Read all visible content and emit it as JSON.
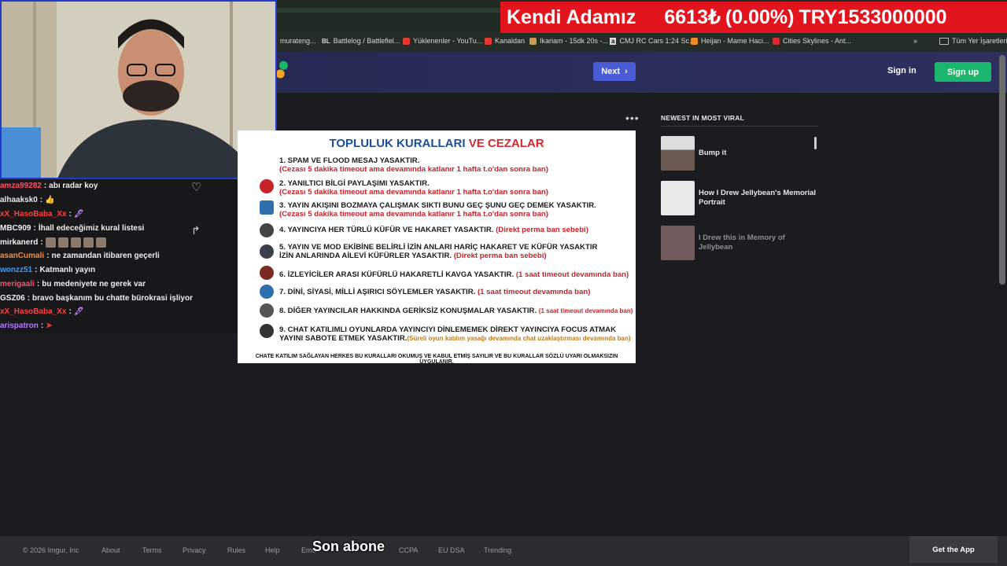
{
  "ticker": {
    "name": "Kendi Adamız",
    "value": "6613₺",
    "change": "(0.00%)",
    "mcap": "TRY1533000000"
  },
  "bookmarks": [
    {
      "label": "murateng...",
      "color": "#555"
    },
    {
      "label": "Battlelog / Battlefiel...",
      "color": "#e8e8e8",
      "glyph": "BL"
    },
    {
      "label": "Yüklenenler - YouTu...",
      "color": "#e53935"
    },
    {
      "label": "Kanaldan",
      "color": "#e53935"
    },
    {
      "label": "Ikariam - 15dk 20s -...",
      "color": "#c99b54"
    },
    {
      "label": "CMJ RC Cars 1:24 Sc...",
      "color": "#ddd",
      "glyph": "a"
    },
    {
      "label": "Heijan - Mame Haci...",
      "color": "#f08a24"
    },
    {
      "label": "Cities Skylines - Ant...",
      "color": "#d32f2f"
    },
    {
      "label": "Tüm Yer İşaretleri",
      "color": "#999"
    }
  ],
  "header": {
    "next_label": "Next",
    "signin_label": "Sign in",
    "signup_label": "Sign up"
  },
  "chat": [
    {
      "user": "amza99282",
      "user_color": "#ff4f6b",
      "text": "abı radar koy"
    },
    {
      "user": "alhaaksk0",
      "user_color": "#e8e8e8",
      "text": "👍"
    },
    {
      "user": "xX_HasoBaba_Xx",
      "user_color": "#ff4040",
      "text": "🖋"
    },
    {
      "user": "MBC909",
      "user_color": "#f0f0f0",
      "text": "İhall edeceğimiz kural listesi"
    },
    {
      "user": "mirkanerd",
      "user_color": "#f0f0f0",
      "text": ""
    },
    {
      "user": "asanCumali",
      "user_color": "#ff8a3a",
      "text": "ne zamandan itibaren geçerli"
    },
    {
      "user": "wonzz51",
      "user_color": "#3aa0ff",
      "text": "Katmanlı yayın"
    },
    {
      "user": "merigaali",
      "user_color": "#ff4f6b",
      "text": "bu medeniyete ne gerek var"
    },
    {
      "user": "GSZ06",
      "user_color": "#f0f0f0",
      "text": "bravo başkanım bu chatte bürokrasi işliyor"
    },
    {
      "user": "xX_HasoBaba_Xx",
      "user_color": "#ff4040",
      "text": "🖋"
    },
    {
      "user": "arispatron",
      "user_color": "#b07aff",
      "text": "➤"
    }
  ],
  "rules": {
    "title_a": "TOPLULUK KURALLARI",
    "title_b": "VE CEZALAR",
    "items": [
      {
        "text": "1. SPAM VE FLOOD MESAJ YASAKTIR.",
        "penalty": "(Cezası 5 dakika timeout ama devamında katlanır 1 hafta t.o'dan sonra ban)"
      },
      {
        "text": "2. YANILTICI BİLGİ PAYLAŞIMI YASAKTIR.",
        "penalty": "(Cezası 5 dakika timeout ama devamında katlanır 1 hafta t.o'dan sonra ban)"
      },
      {
        "text": "3. YAYIN AKIŞINI BOZMAYA ÇALIŞMAK SIKTI BUNU GEÇ ŞUNU GEÇ DEMEK YASAKTIR.",
        "penalty": "(Cezası 5 dakika timeout ama devamında katlanır 1 hafta t.o'dan sonra ban)"
      },
      {
        "text": "4. YAYINCIYA HER TÜRLÜ KÜFÜR VE HAKARET YASAKTIR.",
        "penalty": "(Direkt perma ban sebebi)"
      },
      {
        "text": "5. YAYIN VE MOD EKİBİNE BELİRLİ İZİN ANLARI HARİÇ HAKARET VE KÜFÜR YASAKTIR",
        "text2": "İZİN ANLARINDA AİLEVİ KÜFÜRLER YASAKTIR.",
        "penalty": "(Direkt perma ban sebebi)"
      },
      {
        "text": "6. İZLEYİCİLER ARASI KÜFÜRLÜ HAKARETLİ KAVGA YASAKTIR.",
        "penalty": "(1 saat timeout devamında ban)"
      },
      {
        "text": "7. DİNİ, SİYASİ, MİLLİ AŞIRICI SÖYLEMLER YASAKTIR.",
        "penalty": "(1 saat timeout devamında ban)"
      },
      {
        "text": "8. DİĞER YAYINCILAR HAKKINDA GERİKSİZ KONUŞMALAR YASAKTIR.",
        "penalty": "(1 saat timeout devamında ban)"
      },
      {
        "text": "9. CHAT KATILIMLI OYUNLARDA YAYINCIYI DİNLEMEMEK DİREKT YAYINCIYA FOCUS ATMAK",
        "text2": "YAYINI SABOTE ETMEK YASAKTIR.",
        "penalty": "(Süreli oyun katılım yasağı devamında chat uzaklaştırması devamında ban)"
      }
    ],
    "footer": "CHATE KATILIM SAĞLAYAN HERKES BU KURALLARI OKUMUŞ VE KABUL ETMİŞ SAYILIR VE BU KURALLAR SÖZLÜ UYARI OLMAKSIZIN UYGULANIR."
  },
  "sidebar": {
    "title": "NEWEST IN MOST VIRAL",
    "items": [
      {
        "label": "Bump it",
        "thumb": "#6b5a52"
      },
      {
        "label": "How I Drew Jellybean's Memorial Portrait",
        "thumb": "#e8e8e8"
      },
      {
        "label": "I Drew this in Memory of Jellybean",
        "thumb": "#b98f8f"
      }
    ]
  },
  "footer": {
    "links": [
      "© 2026 Imgur, Inc",
      "About",
      "Terms",
      "Privacy",
      "Rules",
      "Help",
      "Emo",
      "CCPA",
      "EU DSA",
      "Trending"
    ],
    "get_app": "Get the App"
  },
  "caption": "Son abone"
}
